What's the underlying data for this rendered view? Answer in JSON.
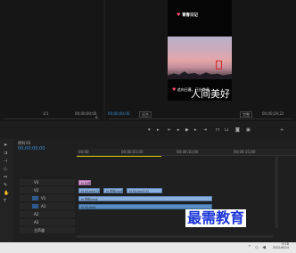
{
  "source": {
    "timecode_left": "1/1",
    "timecode_right": "00;00;00;00"
  },
  "program": {
    "timecode_current": "00;00;00;00",
    "fit_label": "适合",
    "quality_label": "完整",
    "timecode_duration": "00;00;29;22"
  },
  "video": {
    "title_text": "青春日记",
    "caption_line1": "追向日暮，日出常温",
    "caption_line2": "人间美好",
    "heart_icon": "heart-icon"
  },
  "transport": {
    "buttons": [
      "mark-in",
      "mark-out",
      "go-to-in",
      "step-back",
      "play",
      "step-forward",
      "go-to-out",
      "lift",
      "extract",
      "export-frame",
      "compare"
    ]
  },
  "timeline": {
    "tab_label": "序列 01",
    "current_time": "00;00;00;00",
    "ruler_ticks": [
      "00;00",
      "00;00;05;00",
      "00;00;10;00",
      "00;00;15;00"
    ],
    "tracks": [
      {
        "label": "V3"
      },
      {
        "label": "V2"
      },
      {
        "label": "V1"
      },
      {
        "label": "A1"
      },
      {
        "label": "A2"
      },
      {
        "label": "A3"
      },
      {
        "label": "主声道"
      }
    ],
    "clips": {
      "title_clip": "fx 片段",
      "video_clip_1": "fx 04.mp4 [V]",
      "video_clip_2": "fx 视频.mp4",
      "audio_clip": "fx 04.mp4"
    }
  },
  "watermark": {
    "text": "最需教育"
  },
  "taskbar": {
    "time": "9:18",
    "date": "2021/6/24"
  },
  "colors": {
    "accent_blue": "#3a8fd4",
    "video_clip": "#8ab0dd",
    "audio_clip": "#5a8cbf",
    "title_clip": "#d79ad2",
    "watermark": "#1b35d8"
  }
}
